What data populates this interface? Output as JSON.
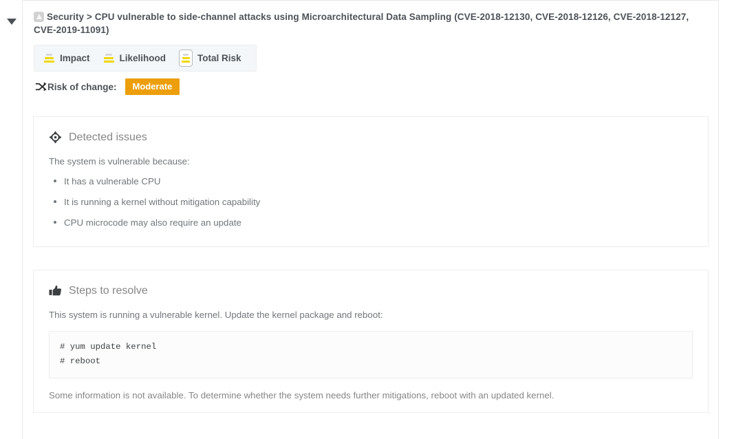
{
  "panel": {
    "collapse_icon": "caret-down-icon",
    "expanded": true
  },
  "rule": {
    "category_icon": "security-shield-icon",
    "title": "Security > CPU vulnerable to side-channel attacks using Microarchitectural Data Sampling (CVE-2018-12130, CVE-2018-12126, CVE-2018-12127, CVE-2019-11091)"
  },
  "severity_tabs": [
    {
      "label": "Impact",
      "icon": "severity-bars-icon",
      "filled_bars": 2,
      "total_bars": 3,
      "selected": false
    },
    {
      "label": "Likelihood",
      "icon": "severity-bars-icon",
      "filled_bars": 2,
      "total_bars": 3,
      "selected": false
    },
    {
      "label": "Total Risk",
      "icon": "severity-bars-icon",
      "filled_bars": 2,
      "total_bars": 3,
      "selected": true
    }
  ],
  "risk_of_change": {
    "icon": "shuffle-icon",
    "label": "Risk of change:",
    "value": "Moderate",
    "badge_color": "#ec9f0b"
  },
  "detected_issues": {
    "icon": "crosshairs-icon",
    "title": "Detected issues",
    "intro": "The system is vulnerable because:",
    "items": [
      "It has a vulnerable CPU",
      "It is running a kernel without mitigation capability",
      "CPU microcode may also require an update"
    ]
  },
  "steps_to_resolve": {
    "icon": "thumbs-up-icon",
    "title": "Steps to resolve",
    "intro": "This system is running a vulnerable kernel. Update the kernel package and reboot:",
    "code": "# yum update kernel\n# reboot",
    "note": "Some information is not available. To determine whether the system needs further mitigations, reboot with an updated kernel."
  },
  "colors": {
    "severity_on": "#f0d800",
    "severity_off": "#d8d8d8",
    "accent_warning": "#ec9f0b",
    "text_dark": "#4d5258",
    "text_muted": "#72767b",
    "border": "#ededed"
  }
}
